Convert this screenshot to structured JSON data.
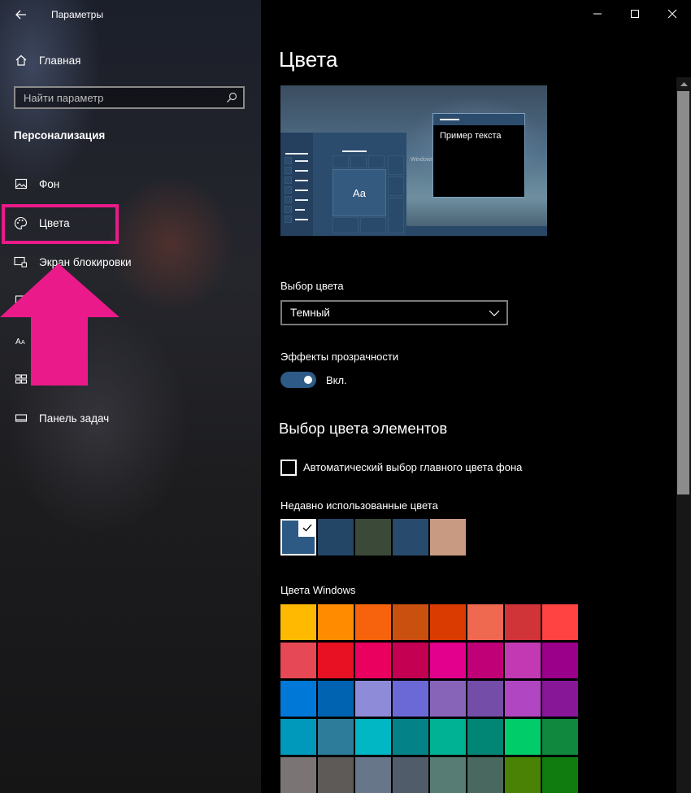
{
  "window": {
    "title": "Параметры"
  },
  "sidebar": {
    "home_label": "Главная",
    "search_placeholder": "Найти параметр",
    "section_title": "Персонализация",
    "items": [
      {
        "label": "Фон",
        "icon": "picture-icon"
      },
      {
        "label": "Цвета",
        "icon": "palette-icon"
      },
      {
        "label": "Экран блокировки",
        "icon": "lock-screen-icon"
      },
      {
        "label": "",
        "icon": "themes-icon"
      },
      {
        "label": "",
        "icon": "fonts-icon"
      },
      {
        "label": "",
        "icon": "start-icon"
      },
      {
        "label": "Панель задач",
        "icon": "taskbar-icon"
      }
    ],
    "highlight_color": "#ea1a8a"
  },
  "main": {
    "page_title": "Цвета",
    "preview": {
      "sample_text": "Пример текста",
      "tile_text": "Aa",
      "logo_text": "Windows"
    },
    "color_choice": {
      "label": "Выбор цвета",
      "selected": "Темный"
    },
    "transparency": {
      "label": "Эффекты прозрачности",
      "state": "Вкл.",
      "on": true
    },
    "accent_section_title": "Выбор цвета элементов",
    "auto_accent": {
      "label": "Автоматический выбор главного цвета фона",
      "checked": false
    },
    "recent_colors": {
      "label": "Недавно использованные цвета",
      "colors": [
        "#2c5a85",
        "#234666",
        "#3b4a38",
        "#284a6c",
        "#c99a82"
      ],
      "selected_index": 0
    },
    "windows_colors": {
      "label": "Цвета Windows",
      "colors": [
        "#ffb900",
        "#ff8c00",
        "#f7630c",
        "#ca5010",
        "#da3b01",
        "#ef6950",
        "#d13438",
        "#ff4343",
        "#e74856",
        "#e81123",
        "#ea005e",
        "#c30052",
        "#e3008c",
        "#bf0077",
        "#c239b3",
        "#9a0089",
        "#0078d7",
        "#0063b1",
        "#8e8cd8",
        "#6b69d6",
        "#8764b8",
        "#744da9",
        "#b146c2",
        "#881798",
        "#0099bc",
        "#2d7d9a",
        "#00b7c3",
        "#038387",
        "#00b294",
        "#018574",
        "#00cc6a",
        "#10893e",
        "#7a7574",
        "#5d5a58",
        "#68768a",
        "#515c6b",
        "#567c73",
        "#486860",
        "#498205",
        "#107c10"
      ]
    }
  }
}
